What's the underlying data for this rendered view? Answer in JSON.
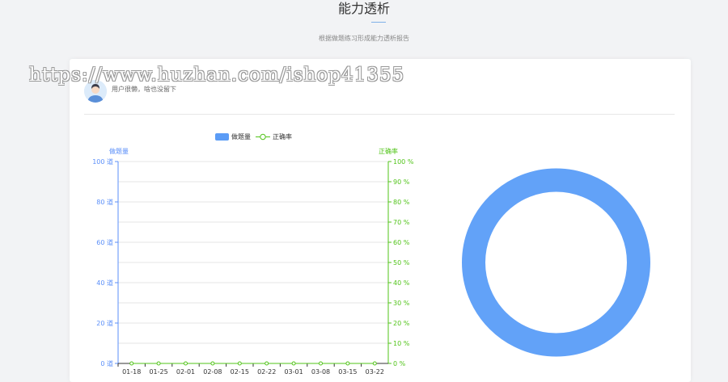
{
  "header": {
    "title": "能力透析",
    "subtitle": "根据做题练习形成能力透析报告"
  },
  "user": {
    "note": "用户很懒，啥也没留下"
  },
  "watermark": "https://www.huzhan.com/ishop41355",
  "colors": {
    "count_axis": "#5b8ff9",
    "rate_axis": "#52c41a",
    "count_series": "#5b9cf6",
    "donut": "#62a2f8"
  },
  "chart_data": [
    {
      "type": "bar",
      "legend": [
        "做题量",
        "正确率"
      ],
      "legend_position": "top",
      "categories": [
        "01-18",
        "01-25",
        "02-01",
        "02-08",
        "02-15",
        "02-22",
        "03-01",
        "03-08",
        "03-15",
        "03-22"
      ],
      "series": [
        {
          "name": "做题量",
          "type": "bar",
          "axis": "left",
          "values": [
            0,
            0,
            0,
            0,
            0,
            0,
            0,
            0,
            0,
            0
          ]
        },
        {
          "name": "正确率",
          "type": "line",
          "axis": "right",
          "values": [
            0,
            0,
            0,
            0,
            0,
            0,
            0,
            0,
            0,
            0
          ]
        }
      ],
      "y_left": {
        "label": "做题量",
        "ylim": [
          0,
          100
        ],
        "ticks": [
          "0 道",
          "20 道",
          "40 道",
          "60 道",
          "80 道",
          "100 道"
        ]
      },
      "y_right": {
        "label": "正确率",
        "ylim": [
          0,
          100
        ],
        "ticks": [
          "0 %",
          "10 %",
          "20 %",
          "30 %",
          "40 %",
          "50 %",
          "60 %",
          "70 %",
          "80 %",
          "90 %",
          "100 %"
        ]
      },
      "grid": true
    },
    {
      "type": "pie",
      "style": "donut",
      "values": [
        1
      ]
    }
  ]
}
